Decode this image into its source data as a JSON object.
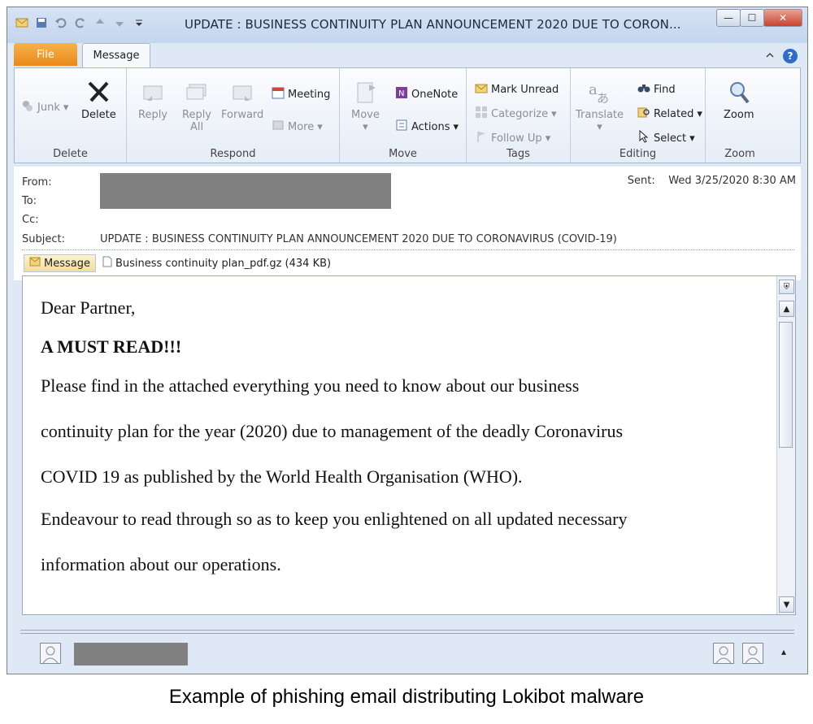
{
  "window": {
    "title": "UPDATE : BUSINESS CONTINUITY PLAN  ANNOUNCEMENT 2020 DUE TO CORON...",
    "controls": {
      "minimize": "—",
      "maximize": "☐",
      "close": "✕"
    }
  },
  "tabs": {
    "file": "File",
    "message": "Message"
  },
  "ribbon": {
    "delete_group": {
      "label": "Delete",
      "junk": "Junk",
      "delete": "Delete"
    },
    "respond_group": {
      "label": "Respond",
      "reply": "Reply",
      "reply_all_line1": "Reply",
      "reply_all_line2": "All",
      "forward": "Forward",
      "meeting": "Meeting",
      "more": "More"
    },
    "move_group": {
      "label": "Move",
      "move": "Move",
      "onenote": "OneNote",
      "actions": "Actions"
    },
    "tags_group": {
      "label": "Tags",
      "mark_unread": "Mark Unread",
      "categorize": "Categorize",
      "follow_up": "Follow Up"
    },
    "editing_group": {
      "label": "Editing",
      "translate": "Translate",
      "find": "Find",
      "related": "Related",
      "select": "Select"
    },
    "zoom_group": {
      "label": "Zoom",
      "zoom": "Zoom"
    }
  },
  "header": {
    "from_label": "From:",
    "to_label": "To:",
    "cc_label": "Cc:",
    "subject_label": "Subject:",
    "subject": "UPDATE : BUSINESS CONTINUITY PLAN  ANNOUNCEMENT 2020 DUE TO CORONAVIRUS (COVID-19)",
    "sent_label": "Sent:",
    "sent_value": "Wed 3/25/2020 8:30 AM"
  },
  "attachments": {
    "message_tab": "Message",
    "file": "Business continuity plan_pdf.gz (434 KB)"
  },
  "body": {
    "greeting": "Dear Partner,",
    "headline": "A MUST READ!!!",
    "line1": "Please find in the attached everything you need to know about our business",
    "line2": "continuity plan for the year (2020) due to management of the deadly Coronavirus",
    "line3": "COVID 19 as published by the World Health Organisation (WHO).",
    "line4": "Endeavour to read through so as to keep you enlightened on all updated necessary",
    "line5": "information about our operations."
  },
  "caption": "Example of phishing email distributing Lokibot malware",
  "colors": {
    "file_tab": "#e8891a",
    "redaction": "#808080",
    "help": "#2e6dc9"
  }
}
